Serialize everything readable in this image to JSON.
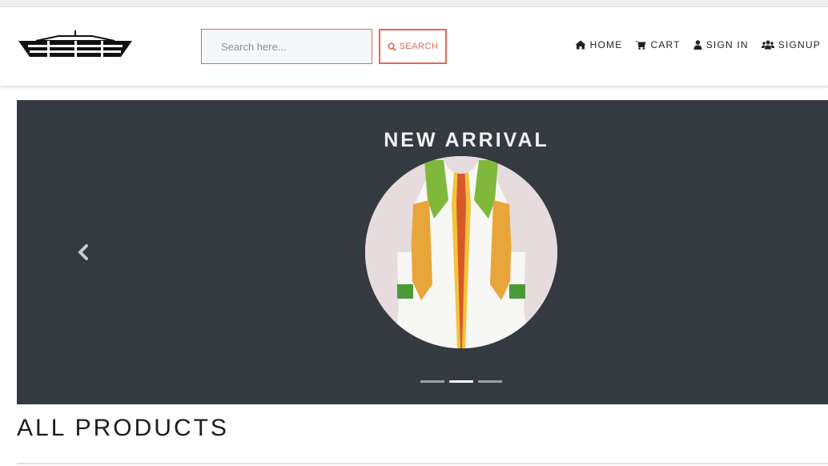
{
  "search": {
    "placeholder": "Search here...",
    "button_label": "SEARCH"
  },
  "nav": {
    "items": [
      {
        "label": "HOME",
        "icon": "home-icon"
      },
      {
        "label": "CART",
        "icon": "cart-icon"
      },
      {
        "label": "SIGN IN",
        "icon": "user-icon"
      },
      {
        "label": "SIGNUP",
        "icon": "users-icon"
      }
    ]
  },
  "carousel": {
    "title": "NEW ARRIVAL",
    "prev_icon": "chevron-left-icon",
    "slide_count": 3,
    "active_slide": 2
  },
  "products": {
    "heading": "ALL PRODUCTS"
  },
  "colors": {
    "accent": "#e0685a",
    "carousel_bg": "#343a40",
    "text_dark": "#1f2327"
  }
}
